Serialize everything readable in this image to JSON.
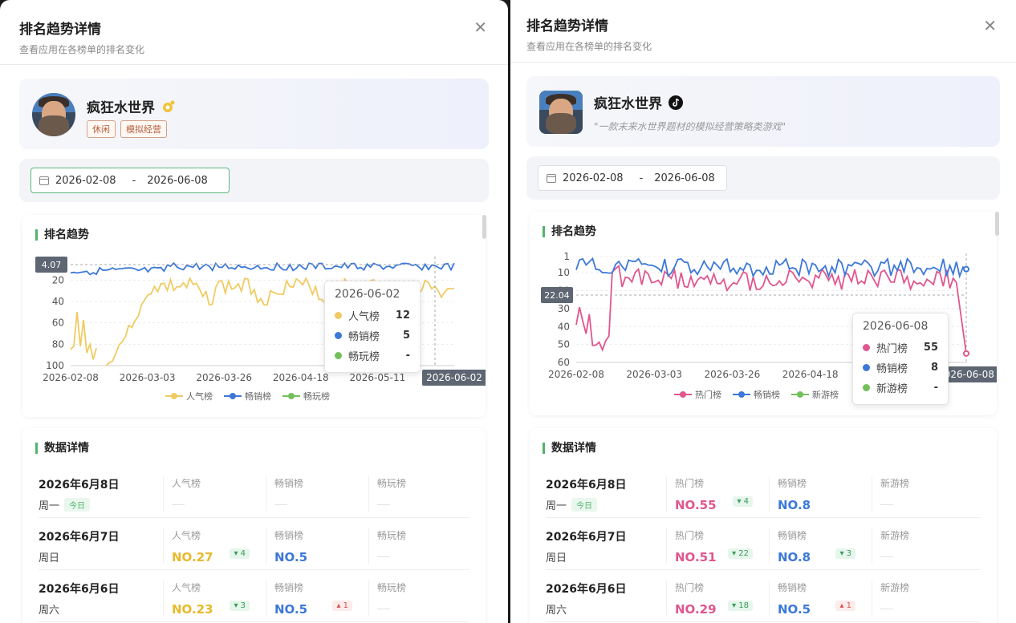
{
  "panels": [
    {
      "title": "排名趋势详情",
      "subtitle": "查看应用在各榜单的排名变化",
      "app": {
        "name": "疯狂水世界",
        "tags": [
          "休闲",
          "模拟经营"
        ],
        "platform_icon": "mini-game-icon"
      },
      "date_start": "2026-02-08",
      "date_sep": "-",
      "date_end": "2026-06-08",
      "trend_title": "排名趋势",
      "detail_title": "数据详情",
      "chart_data": {
        "type": "line",
        "x_ticks": [
          "2026-02-08",
          "2026-03-03",
          "2026-03-26",
          "2026-04-18",
          "2026-05-11",
          "2026-06-02"
        ],
        "y_ticks": [
          "20",
          "40",
          "60",
          "80",
          "100"
        ],
        "ylim": [
          1,
          100
        ],
        "y_inverted": true,
        "y_pointer_label": "4.07",
        "x_pointer_label": "2026-06-02",
        "series": [
          {
            "name": "人气榜",
            "color": "#f0cb62"
          },
          {
            "name": "畅销榜",
            "color": "#3d78d8"
          },
          {
            "name": "畅玩榜",
            "color": "#73c05a"
          }
        ],
        "tooltip": {
          "date": "2026-06-02",
          "rows": [
            {
              "name": "人气榜",
              "value": "12",
              "color": "#f0cb62"
            },
            {
              "name": "畅销榜",
              "value": "5",
              "color": "#3d78d8"
            },
            {
              "name": "畅玩榜",
              "value": "-",
              "color": "#73c05a"
            }
          ]
        }
      },
      "columns": [
        "人气榜",
        "畅销榜",
        "畅玩榜"
      ],
      "rows": [
        {
          "date": "2026年6月8日",
          "weekday": "周一",
          "badge": "今日",
          "cells": [
            {
              "value": "",
              "change": ""
            },
            {
              "value": "",
              "change": ""
            },
            {
              "value": "",
              "change": ""
            }
          ]
        },
        {
          "date": "2026年6月7日",
          "weekday": "周日",
          "badge": "",
          "cells": [
            {
              "value": "NO.27",
              "change": "▾ 4"
            },
            {
              "value": "NO.5",
              "change": ""
            },
            {
              "value": "",
              "change": ""
            }
          ]
        },
        {
          "date": "2026年6月6日",
          "weekday": "周六",
          "badge": "",
          "cells": [
            {
              "value": "NO.23",
              "change": "▾ 3"
            },
            {
              "value": "NO.5",
              "change": "▴ 1"
            },
            {
              "value": "",
              "change": ""
            }
          ]
        }
      ],
      "value_colors": [
        "#e8b92a",
        "#3d78d8",
        "#73c05a"
      ]
    },
    {
      "title": "排名趋势详情",
      "subtitle": "查看应用在各榜单的排名变化",
      "app": {
        "name": "疯狂水世界",
        "slogan": "\"一款末来水世界题材的模拟经营策略类游戏\"",
        "platform_icon": "tiktok-icon"
      },
      "date_start": "2026-02-08",
      "date_sep": "-",
      "date_end": "2026-06-08",
      "trend_title": "排名趋势",
      "detail_title": "数据详情",
      "chart_data": {
        "type": "line",
        "x_ticks": [
          "2026-02-08",
          "2026-03-03",
          "2026-03-26",
          "2026-04-18",
          "2026-05-11",
          "2026-06-08"
        ],
        "y_ticks": [
          "1",
          "10",
          "20",
          "30",
          "40",
          "50",
          "60"
        ],
        "ylim": [
          1,
          60
        ],
        "y_inverted": true,
        "y_pointer_label": "22.04",
        "x_pointer_label": "2026-06-08",
        "series": [
          {
            "name": "热门榜",
            "color": "#e0568e"
          },
          {
            "name": "畅销榜",
            "color": "#3d78d8"
          },
          {
            "name": "新游榜",
            "color": "#73c05a"
          }
        ],
        "tooltip": {
          "date": "2026-06-08",
          "rows": [
            {
              "name": "热门榜",
              "value": "55",
              "color": "#e0568e"
            },
            {
              "name": "畅销榜",
              "value": "8",
              "color": "#3d78d8"
            },
            {
              "name": "新游榜",
              "value": "-",
              "color": "#73c05a"
            }
          ]
        }
      },
      "columns": [
        "热门榜",
        "畅销榜",
        "新游榜"
      ],
      "rows": [
        {
          "date": "2026年6月8日",
          "weekday": "周一",
          "badge": "今日",
          "cells": [
            {
              "value": "NO.55",
              "change": "▾ 4"
            },
            {
              "value": "NO.8",
              "change": ""
            },
            {
              "value": "",
              "change": ""
            }
          ]
        },
        {
          "date": "2026年6月7日",
          "weekday": "周日",
          "badge": "",
          "cells": [
            {
              "value": "NO.51",
              "change": "▾ 22"
            },
            {
              "value": "NO.8",
              "change": "▾ 3"
            },
            {
              "value": "",
              "change": ""
            }
          ]
        },
        {
          "date": "2026年6月6日",
          "weekday": "周六",
          "badge": "",
          "cells": [
            {
              "value": "NO.29",
              "change": "▾ 18"
            },
            {
              "value": "NO.5",
              "change": "▴ 1"
            },
            {
              "value": "",
              "change": ""
            }
          ]
        }
      ],
      "value_colors": [
        "#e0568e",
        "#3d78d8",
        "#73c05a"
      ]
    }
  ]
}
